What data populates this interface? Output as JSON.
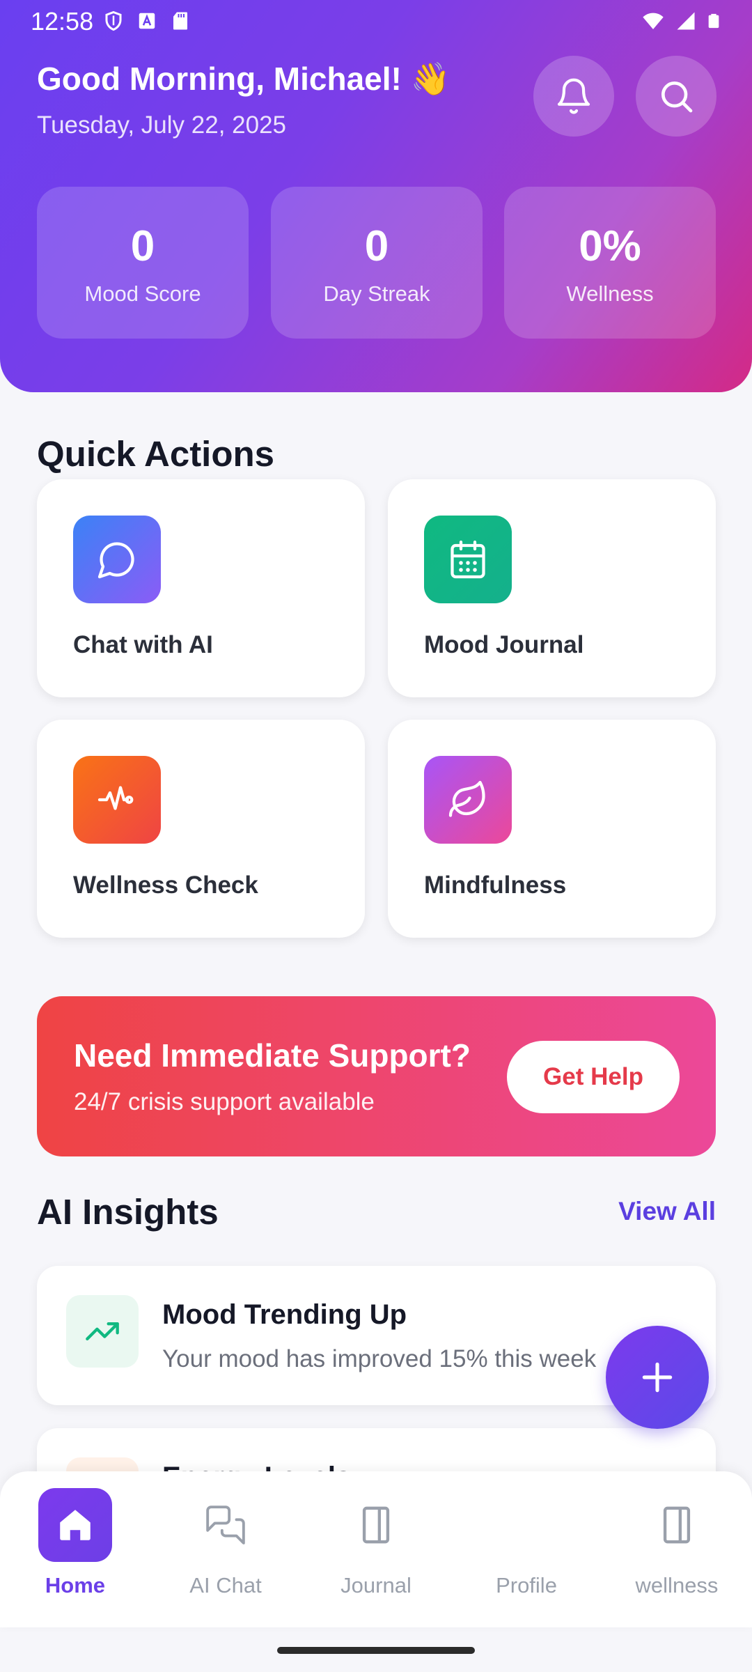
{
  "status_bar": {
    "time": "12:58",
    "left_icons": [
      "shield-icon",
      "font-icon",
      "sd-card-icon"
    ],
    "right_icons": [
      "wifi-icon",
      "signal-icon",
      "battery-icon"
    ]
  },
  "header": {
    "greeting": "Good Morning, Michael! 👋",
    "date": "Tuesday, July 22, 2025",
    "buttons": [
      {
        "name": "notifications-button",
        "icon": "bell-icon"
      },
      {
        "name": "search-button",
        "icon": "search-icon"
      }
    ],
    "stats": [
      {
        "value": "0",
        "label": "Mood Score"
      },
      {
        "value": "0",
        "label": "Day Streak"
      },
      {
        "value": "0%",
        "label": "Wellness"
      }
    ]
  },
  "quick_actions": {
    "title": "Quick Actions",
    "items": [
      {
        "label": "Chat with AI",
        "icon": "chat-bubble-icon",
        "color_from": "#3b82f6",
        "color_to": "#8b5cf6"
      },
      {
        "label": "Mood Journal",
        "icon": "calendar-icon",
        "color_from": "#10b981",
        "color_to": "#14b08c"
      },
      {
        "label": "Wellness Check",
        "icon": "heartbeat-icon",
        "color_from": "#f97316",
        "color_to": "#ef4444"
      },
      {
        "label": "Mindfulness",
        "icon": "leaf-icon",
        "color_from": "#a855f7",
        "color_to": "#ec4899"
      }
    ]
  },
  "support": {
    "title": "Need Immediate Support?",
    "subtitle": "24/7 crisis support available",
    "button": "Get Help"
  },
  "ai_insights": {
    "title": "AI Insights",
    "view_all": "View All",
    "items": [
      {
        "title": "Mood Trending Up",
        "text": "Your mood has improved 15% this week",
        "icon": "trending-up-icon"
      },
      {
        "title": "Energy Levels",
        "text": "",
        "icon": "energy-icon"
      }
    ]
  },
  "fab": {
    "icon": "plus-icon"
  },
  "bottom_nav": {
    "items": [
      {
        "label": "Home",
        "icon": "home-icon",
        "active": true
      },
      {
        "label": "AI Chat",
        "icon": "chat-bubbles-icon",
        "active": false
      },
      {
        "label": "Journal",
        "icon": "book-icon",
        "active": false
      },
      {
        "label": "Profile",
        "icon": "book-icon",
        "active": false
      },
      {
        "label": "wellness",
        "icon": "book-icon",
        "active": false
      }
    ]
  },
  "colors": {
    "brand_purple": "#6b3fe8",
    "header_gradient_start": "#6a3ff0",
    "header_gradient_end": "#d42a86",
    "danger": "#ef4444",
    "pink": "#ec4899"
  }
}
